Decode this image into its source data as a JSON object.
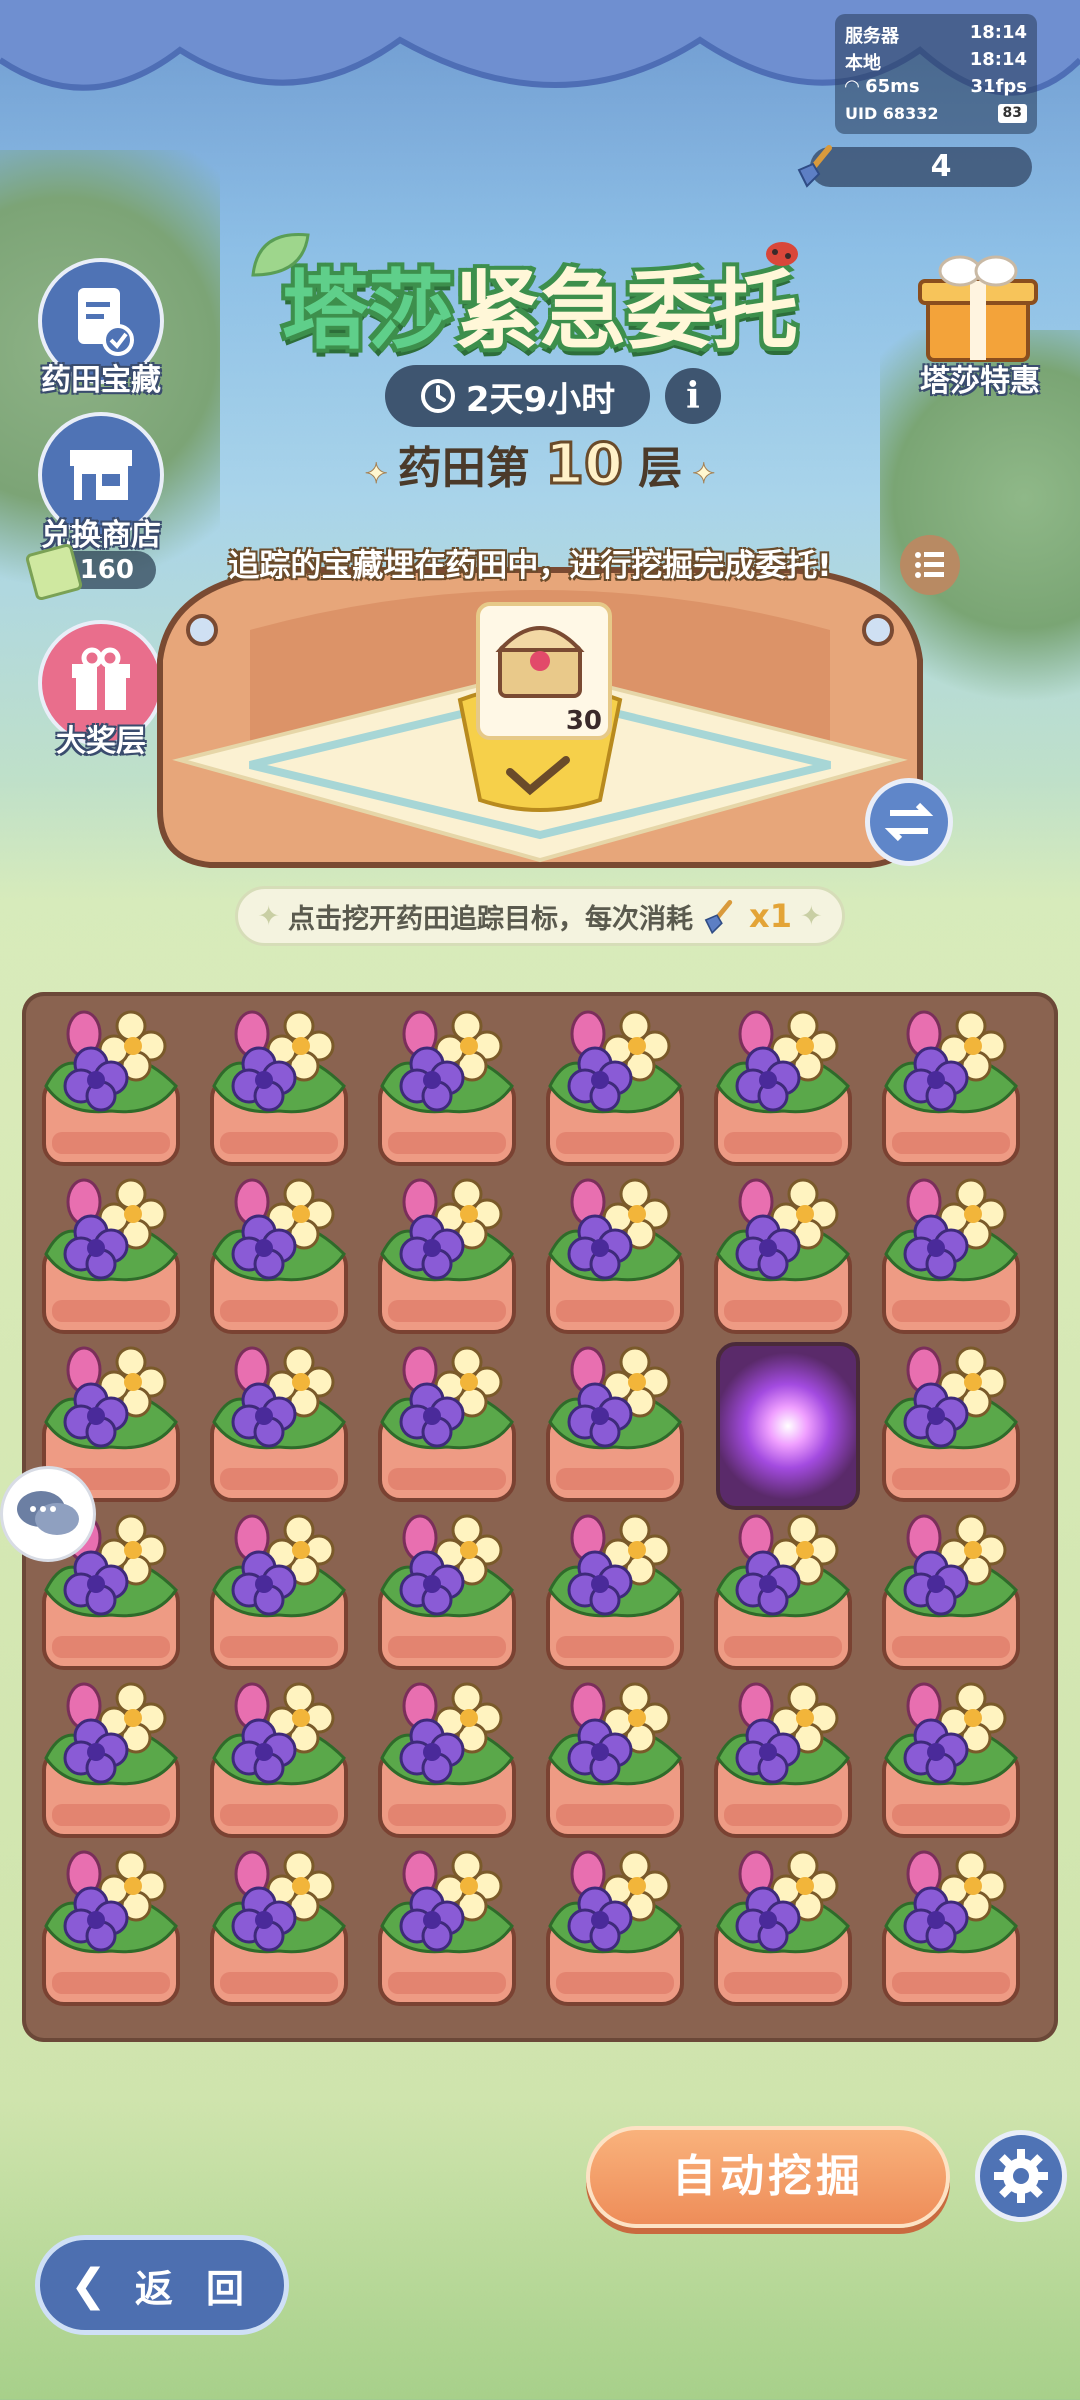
{
  "status": {
    "server_label": "服务器",
    "server_time": "18:14",
    "local_label": "本地",
    "local_time": "18:14",
    "ping": "65ms",
    "fps": "31fps",
    "uid": "UID 68332",
    "battery": "83"
  },
  "shovel_count": "4",
  "title": {
    "part1": "塔莎",
    "part2": "紧急委托"
  },
  "timer": "2天9小时",
  "info_icon": "i",
  "floor": {
    "prefix": "药田第",
    "number": "10",
    "suffix": "层"
  },
  "left_menu": {
    "treasure": "药田宝藏",
    "shop": "兑换商店",
    "coin_count": "160",
    "grand_prize": "大奖层"
  },
  "right_menu": {
    "special": "塔莎特惠"
  },
  "description": "追踪的宝藏埋在药田中，进行挖掘完成委托!",
  "target_count": "30",
  "hint": {
    "text": "点击挖开药田追踪目标，每次消耗",
    "cost": "x1"
  },
  "grid": {
    "rows": 6,
    "cols": 6,
    "dug_cell": [
      2,
      4
    ]
  },
  "buttons": {
    "auto_dig": "自动挖掘",
    "back": "返 回"
  }
}
